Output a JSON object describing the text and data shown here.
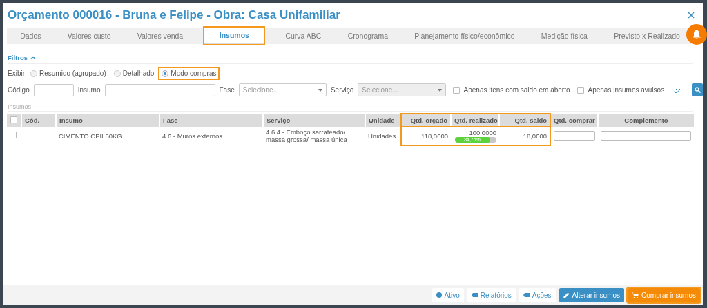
{
  "window": {
    "title": "Orçamento 000016 - Bruna e Felipe - Obra: Casa Unifamiliar"
  },
  "tabs": [
    {
      "label": "Dados",
      "selected": false,
      "highlighted": false
    },
    {
      "label": "Valores custo",
      "selected": false,
      "highlighted": false
    },
    {
      "label": "Valores venda",
      "selected": false,
      "highlighted": false
    },
    {
      "label": "Insumos",
      "selected": true,
      "highlighted": true
    },
    {
      "label": "Curva ABC",
      "selected": false,
      "highlighted": false
    },
    {
      "label": "Cronograma",
      "selected": false,
      "highlighted": false
    },
    {
      "label": "Planejamento físico/econômico",
      "selected": false,
      "highlighted": false
    },
    {
      "label": "Medição física",
      "selected": false,
      "highlighted": false
    },
    {
      "label": "Previsto x Realizado",
      "selected": false,
      "highlighted": false
    }
  ],
  "filters": {
    "title": "Filtros",
    "expanded": true,
    "display_label": "Exibir",
    "display_options": [
      {
        "label": "Resumido (agrupado)",
        "selected": false,
        "highlighted": false
      },
      {
        "label": "Detalhado",
        "selected": false,
        "highlighted": false
      },
      {
        "label": "Modo compras",
        "selected": true,
        "highlighted": true
      }
    ],
    "fields": [
      {
        "kind": "text",
        "label": "Código"
      },
      {
        "kind": "text",
        "label": "Insumo"
      },
      {
        "kind": "select",
        "label": "Fase",
        "placeholder": "Selecione...",
        "disabled": false
      },
      {
        "kind": "select",
        "label": "Serviço",
        "placeholder": "Selecione...",
        "disabled": true
      }
    ],
    "checkboxes": [
      {
        "label": "Apenas itens com saldo em aberto",
        "checked": false
      },
      {
        "label": "Apenas insumos avulsos",
        "checked": false
      }
    ]
  },
  "table": {
    "title": "Insumos",
    "select_all_checked": false,
    "columns": [
      {
        "label": "Cód.",
        "highlighted": false
      },
      {
        "label": "Insumo",
        "highlighted": false
      },
      {
        "label": "Fase",
        "highlighted": false
      },
      {
        "label": "Serviço",
        "highlighted": false
      },
      {
        "label": "Unidade",
        "highlighted": false
      },
      {
        "label": "Qtd. orçado",
        "highlighted": true
      },
      {
        "label": "Qtd. realizado",
        "highlighted": true
      },
      {
        "label": "Qtd. saldo",
        "highlighted": true
      },
      {
        "label": "Qtd. comprar",
        "highlighted": false
      },
      {
        "label": "Complemento",
        "highlighted": false
      }
    ],
    "rows": [
      {
        "checked": false,
        "insumo": "CIMENTO CPII 50KG",
        "fase": "4.6 - Muros externos",
        "servico": "4.6.4 - Emboço sarrafeado/ massa grossa/ massa única",
        "unidade": "Unidades",
        "qtd_orcado": "118,0000",
        "qtd_realizado": "100,0000",
        "progress": {
          "level": 0.8475,
          "label": "84,75%"
        },
        "qtd_saldo": "18,0000"
      }
    ]
  },
  "footer_buttons": [
    {
      "kind": "status",
      "label": "Ativo",
      "highlighted": false
    },
    {
      "kind": "menu",
      "label": "Relatórios",
      "highlighted": false
    },
    {
      "kind": "menu",
      "label": "Ações",
      "highlighted": false
    },
    {
      "kind": "edit",
      "label": "Alterar insumos",
      "highlighted": false
    },
    {
      "kind": "buy",
      "label": "Comprar insumos",
      "highlighted": true
    }
  ]
}
